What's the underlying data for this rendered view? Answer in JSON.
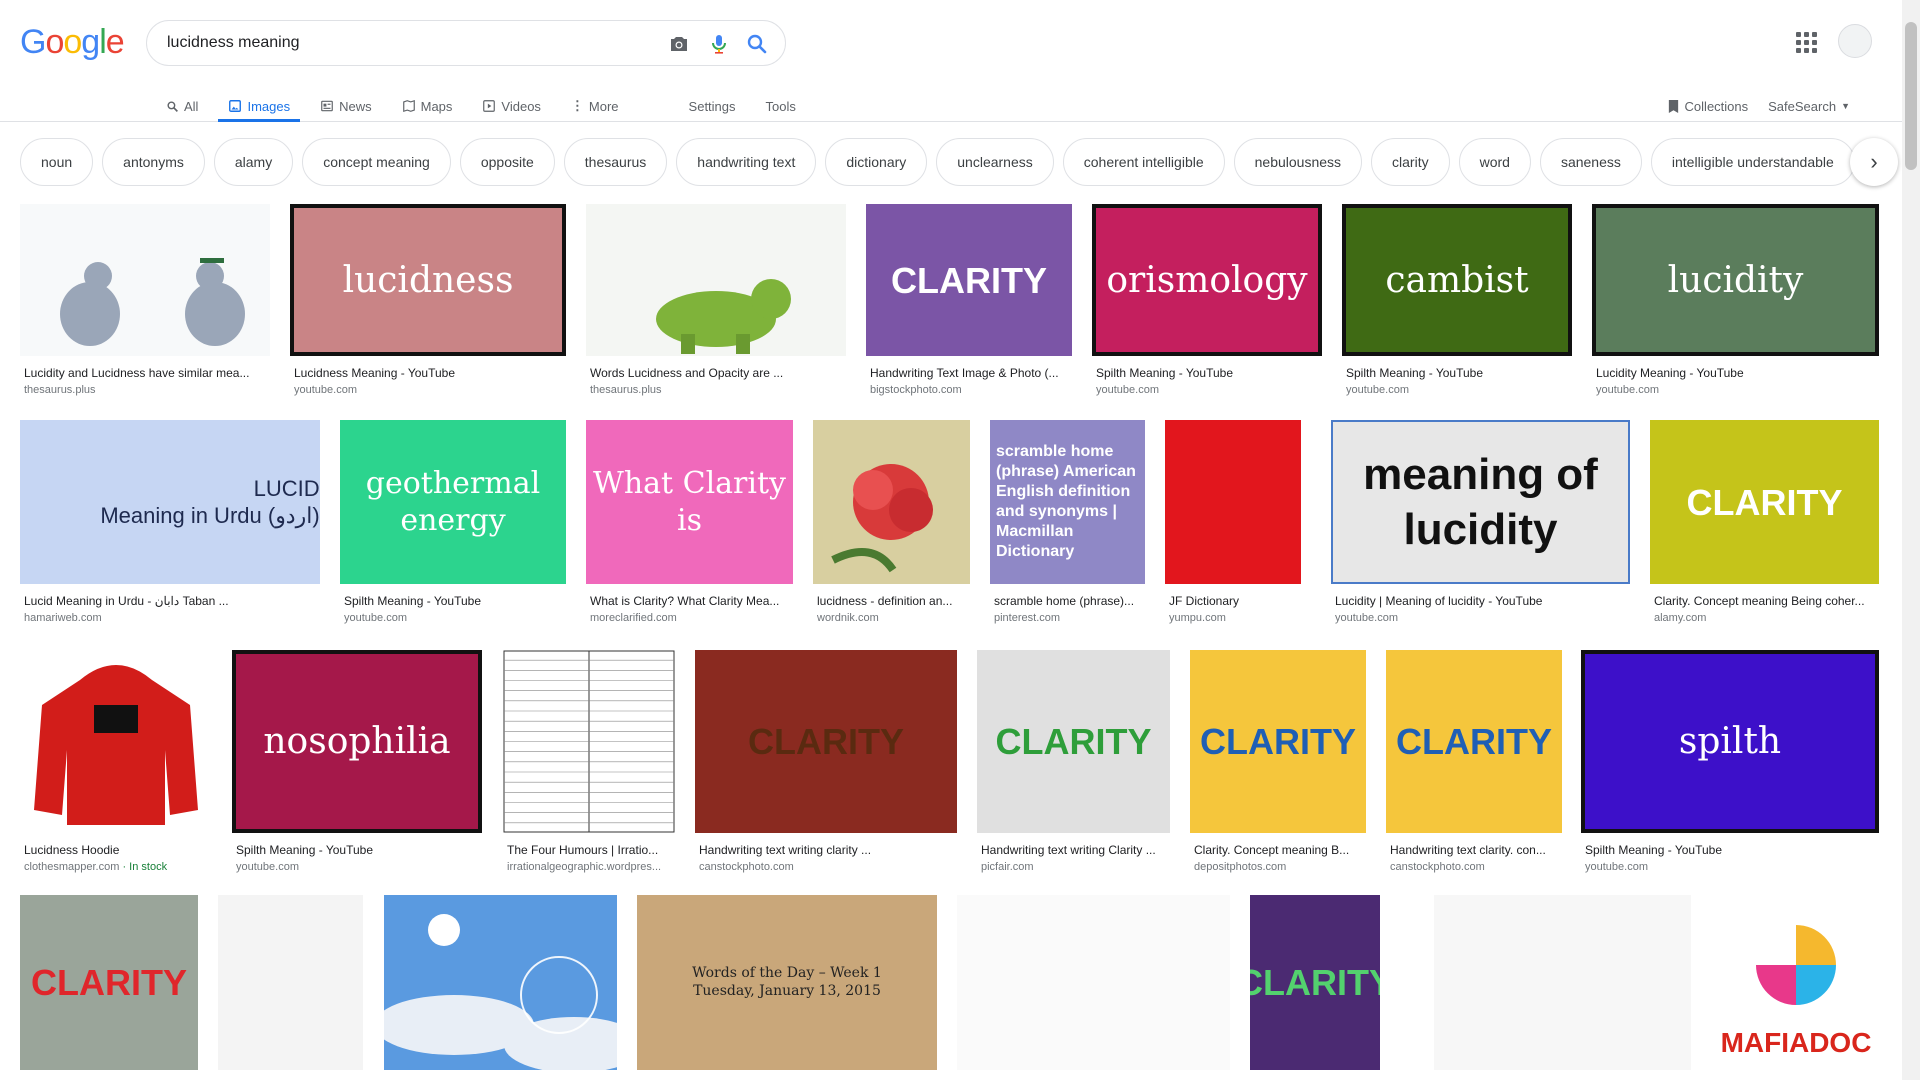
{
  "header": {
    "logo_letters": [
      {
        "ch": "G",
        "color": "#4285F4"
      },
      {
        "ch": "o",
        "color": "#EA4335"
      },
      {
        "ch": "o",
        "color": "#FBBC05"
      },
      {
        "ch": "g",
        "color": "#4285F4"
      },
      {
        "ch": "l",
        "color": "#34A853"
      },
      {
        "ch": "e",
        "color": "#EA4335"
      }
    ],
    "search_query": "lucidness meaning",
    "icons": [
      "camera-icon",
      "microphone-icon",
      "search-icon",
      "apps-icon"
    ]
  },
  "nav": {
    "all": "All",
    "images": "Images",
    "news": "News",
    "maps": "Maps",
    "videos": "Videos",
    "more": "More",
    "settings": "Settings",
    "tools": "Tools",
    "collections": "Collections",
    "safesearch": "SafeSearch"
  },
  "chips": [
    "noun",
    "antonyms",
    "alamy",
    "concept meaning",
    "opposite",
    "thesaurus",
    "handwriting text",
    "dictionary",
    "unclearness",
    "coherent intelligible",
    "nebulousness",
    "clarity",
    "word",
    "saneness",
    "intelligible understandable"
  ],
  "results": [
    {
      "title": "Lucidity and Lucidness have similar mea...",
      "source": "thesaurus.plus",
      "thumb_text": "",
      "bg": "#f7f9fa",
      "fg": "#333"
    },
    {
      "title": "Lucidness Meaning - YouTube",
      "source": "youtube.com",
      "thumb_text": "lucidness",
      "bg": "#c98486",
      "fg": "#fff"
    },
    {
      "title": "Words Lucidness and Opacity are ...",
      "source": "thesaurus.plus",
      "thumb_text": "",
      "bg": "#f4f6f3",
      "fg": "#333"
    },
    {
      "title": "Handwriting Text Image & Photo (...",
      "source": "bigstockphoto.com",
      "thumb_text": "CLARITY",
      "bg": "#7b55a6",
      "fg": "#fff"
    },
    {
      "title": "Spilth Meaning - YouTube",
      "source": "youtube.com",
      "thumb_text": "orismology",
      "bg": "#c41f5e",
      "fg": "#fff"
    },
    {
      "title": "Spilth Meaning - YouTube",
      "source": "youtube.com",
      "thumb_text": "cambist",
      "bg": "#3f6a14",
      "fg": "#fff"
    },
    {
      "title": "Lucidity Meaning - YouTube",
      "source": "youtube.com",
      "thumb_text": "lucidity",
      "bg": "#5b7d5c",
      "fg": "#fff"
    },
    {
      "title": "Lucid Meaning in Urdu - دابان Taban ...",
      "source": "hamariweb.com",
      "thumb_text": "LUCID\nMeaning in Urdu (اردو)",
      "bg": "#c6d6f3",
      "fg": "#1e2a4f"
    },
    {
      "title": "Spilth Meaning - YouTube",
      "source": "youtube.com",
      "thumb_text": "geothermal energy",
      "bg": "#2cd48e",
      "fg": "#fff"
    },
    {
      "title": "What is Clarity? What Clarity Mea...",
      "source": "moreclarified.com",
      "thumb_text": "What Clarity is",
      "bg": "#f069bb",
      "fg": "#fff"
    },
    {
      "title": "lucidness - definition an...",
      "source": "wordnik.com",
      "thumb_text": "",
      "bg": "#d8cfa0",
      "fg": "#333"
    },
    {
      "title": "scramble home (phrase)...",
      "source": "pinterest.com",
      "thumb_text": "scramble home (phrase) American English definition and synonyms | Macmillan Dictionary",
      "bg": "#8f88c6",
      "fg": "#fff"
    },
    {
      "title": "JF Dictionary",
      "source": "yumpu.com",
      "thumb_text": "",
      "bg": "#e2161d",
      "fg": "#fff"
    },
    {
      "title": "Lucidity | Meaning of lucidity - YouTube",
      "source": "youtube.com",
      "thumb_text": "meaning of lucidity",
      "bg": "#e7e7e7",
      "fg": "#111"
    },
    {
      "title": "Clarity. Concept meaning Being coher...",
      "source": "alamy.com",
      "thumb_text": "CLARITY",
      "bg": "#c5c41a",
      "fg": "#fff"
    },
    {
      "title": "Lucidness Hoodie",
      "source": "clothesmapper.com",
      "source_extra": " · In stock",
      "thumb_text": "",
      "bg": "#ffffff",
      "fg": "#fff"
    },
    {
      "title": "Spilth Meaning - YouTube",
      "source": "youtube.com",
      "thumb_text": "nosophilia",
      "bg": "#a5184a",
      "fg": "#fff"
    },
    {
      "title": "The Four Humours | Irratio...",
      "source": "irrationalgeographic.wordpres...",
      "thumb_text": "",
      "bg": "#ffffff",
      "fg": "#222"
    },
    {
      "title": "Handwriting text writing clarity ...",
      "source": "canstockphoto.com",
      "thumb_text": "CLARITY",
      "bg": "#8a2a20",
      "fg": "#5a2a10"
    },
    {
      "title": "Handwriting text writing Clarity ...",
      "source": "picfair.com",
      "thumb_text": "CLARITY",
      "bg": "#e0e0e0",
      "fg": "#2e9e3a"
    },
    {
      "title": "Clarity. Concept meaning B...",
      "source": "depositphotos.com",
      "thumb_text": "CLARITY",
      "bg": "#f5c63c",
      "fg": "#1f5fb5"
    },
    {
      "title": "Handwriting text clarity. con...",
      "source": "canstockphoto.com",
      "thumb_text": "CLARITY",
      "bg": "#f5c63c",
      "fg": "#1f5fb5"
    },
    {
      "title": "Spilth Meaning - YouTube",
      "source": "youtube.com",
      "thumb_text": "spilth",
      "bg": "#3d10c9",
      "fg": "#fff"
    },
    {
      "title": "",
      "source": "",
      "thumb_text": "CLARITY",
      "bg": "#9aa59a",
      "fg": "#e0262b"
    },
    {
      "title": "",
      "source": "",
      "thumb_text": "",
      "bg": "#f4f4f4",
      "fg": "#333"
    },
    {
      "title": "",
      "source": "",
      "thumb_text": "",
      "bg": "#3f84d3",
      "fg": "#fff"
    },
    {
      "title": "",
      "source": "",
      "thumb_text": "Words of the Day – Week 1\nTuesday, January 13, 2015",
      "bg": "#c9a77a",
      "fg": "#222"
    },
    {
      "title": "",
      "source": "",
      "thumb_text": "",
      "bg": "#fafafa",
      "fg": "#333"
    },
    {
      "title": "",
      "source": "",
      "thumb_text": "CLARITY",
      "bg": "#4b2a72",
      "fg": "#53d16e"
    },
    {
      "title": "",
      "source": "",
      "thumb_text": "",
      "bg": "#f7f7f7",
      "fg": "#333"
    },
    {
      "title": "",
      "source": "",
      "thumb_text": "MAFIADOC",
      "bg": "#ffffff",
      "fg": "#d9261c"
    }
  ]
}
